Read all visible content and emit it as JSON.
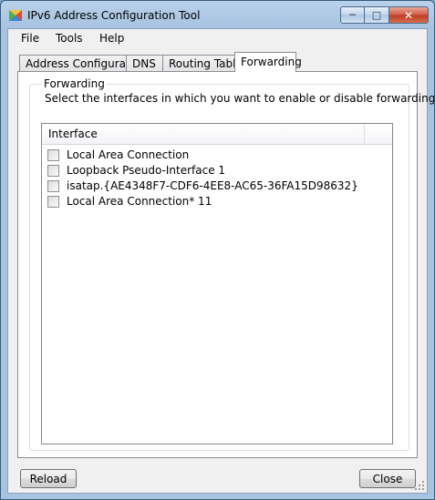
{
  "window": {
    "title": "IPv6 Address Configuration Tool",
    "caption": {
      "minimize": "─",
      "maximize": "□",
      "close": "✕"
    }
  },
  "menu": {
    "items": [
      "File",
      "Tools",
      "Help"
    ]
  },
  "tabs": [
    {
      "label": "Address Configuration",
      "active": false
    },
    {
      "label": "DNS",
      "active": false
    },
    {
      "label": "Routing Table",
      "active": false
    },
    {
      "label": "Forwarding",
      "active": true
    }
  ],
  "forwarding": {
    "group_label": "Forwarding",
    "description": "Select the interfaces in which you want to enable or disable forwarding.",
    "list": {
      "column_header": "Interface",
      "rows": [
        {
          "label": "Local Area Connection",
          "checked": false
        },
        {
          "label": "Loopback Pseudo-Interface 1",
          "checked": false
        },
        {
          "label": "isatap.{AE4348F7-CDF6-4EE8-AC65-36FA15D98632}",
          "checked": false
        },
        {
          "label": "Local Area Connection* 11",
          "checked": false
        }
      ]
    }
  },
  "buttons": {
    "reload": "Reload",
    "close": "Close"
  },
  "colors": {
    "accent": "#3a5a7a",
    "close_button": "#cf5b45"
  }
}
